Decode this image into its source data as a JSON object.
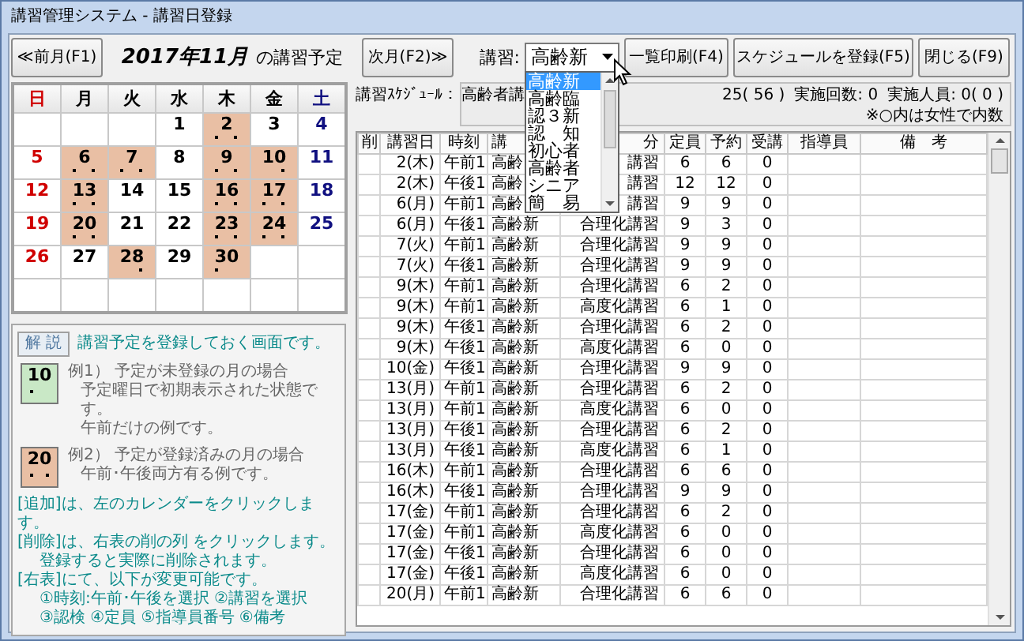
{
  "window": {
    "title": "講習管理システム - 講習日登録"
  },
  "toolbar": {
    "prev_button": "≪前月(F1)",
    "month": "2017年11月",
    "month_caption": "の講習予定",
    "next_button": "次月(F2)≫",
    "course_label": "講習:",
    "course_combo": {
      "value": "高齢新",
      "expanded": true,
      "options": [
        {
          "label": "高齢新",
          "selected": true
        },
        {
          "label": "高齢臨",
          "selected": false
        },
        {
          "label": "認３新",
          "selected": false
        },
        {
          "label": "認　知",
          "selected": false
        },
        {
          "label": "初心者",
          "selected": false
        },
        {
          "label": "高齢者",
          "selected": false
        },
        {
          "label": "シニア",
          "selected": false
        },
        {
          "label": "簡　易",
          "selected": false
        }
      ]
    },
    "buttons": [
      "一覧印刷(F4)",
      "スケジュールを登録(F5)",
      "閉じる(F9)"
    ]
  },
  "calendar": {
    "weekdays": [
      "日",
      "月",
      "火",
      "水",
      "木",
      "金",
      "土"
    ],
    "weeks": [
      [
        {
          "kind": "blank"
        },
        {
          "kind": "blank"
        },
        {
          "kind": "blank"
        },
        {
          "day": "1",
          "scheduled": false,
          "am": false,
          "pm": false
        },
        {
          "day": "2",
          "scheduled": true,
          "am": true,
          "pm": true
        },
        {
          "day": "3",
          "scheduled": false,
          "am": false,
          "pm": false
        },
        {
          "day": "4",
          "scheduled": false,
          "am": false,
          "pm": false
        }
      ],
      [
        {
          "day": "5",
          "scheduled": false,
          "am": false,
          "pm": false
        },
        {
          "day": "6",
          "scheduled": true,
          "am": true,
          "pm": true
        },
        {
          "day": "7",
          "scheduled": true,
          "am": true,
          "pm": true
        },
        {
          "day": "8",
          "scheduled": false,
          "am": false,
          "pm": false
        },
        {
          "day": "9",
          "scheduled": true,
          "am": true,
          "pm": true
        },
        {
          "day": "10",
          "scheduled": true,
          "am": false,
          "pm": true
        },
        {
          "day": "11",
          "scheduled": false,
          "am": false,
          "pm": false
        }
      ],
      [
        {
          "day": "12",
          "scheduled": false,
          "am": false,
          "pm": false
        },
        {
          "day": "13",
          "scheduled": true,
          "am": true,
          "pm": true
        },
        {
          "day": "14",
          "scheduled": false,
          "am": false,
          "pm": false
        },
        {
          "day": "15",
          "scheduled": false,
          "am": false,
          "pm": false
        },
        {
          "day": "16",
          "scheduled": true,
          "am": true,
          "pm": true
        },
        {
          "day": "17",
          "scheduled": true,
          "am": true,
          "pm": true
        },
        {
          "day": "18",
          "scheduled": false,
          "am": false,
          "pm": false
        }
      ],
      [
        {
          "day": "19",
          "scheduled": false,
          "am": false,
          "pm": false
        },
        {
          "day": "20",
          "scheduled": true,
          "am": true,
          "pm": true
        },
        {
          "day": "21",
          "scheduled": false,
          "am": false,
          "pm": false
        },
        {
          "day": "22",
          "scheduled": false,
          "am": false,
          "pm": false
        },
        {
          "day": "23",
          "scheduled": true,
          "am": true,
          "pm": true
        },
        {
          "day": "24",
          "scheduled": true,
          "am": true,
          "pm": true
        },
        {
          "day": "25",
          "scheduled": false,
          "am": false,
          "pm": false
        }
      ],
      [
        {
          "day": "26",
          "scheduled": false,
          "am": false,
          "pm": false
        },
        {
          "day": "27",
          "scheduled": false,
          "am": false,
          "pm": false
        },
        {
          "day": "28",
          "scheduled": true,
          "am": false,
          "pm": true
        },
        {
          "day": "29",
          "scheduled": false,
          "am": false,
          "pm": false
        },
        {
          "day": "30",
          "scheduled": true,
          "am": true,
          "pm": false
        },
        {
          "kind": "blank"
        },
        {
          "kind": "blank"
        }
      ]
    ]
  },
  "legend": {
    "label": "解 説",
    "intro": "講習予定を登録しておく画面です。",
    "examples": [
      {
        "kind": "unregistered",
        "day": "10",
        "am": true,
        "pm": false,
        "lines": [
          "例1） 予定が未登録の月の場合",
          "予定曜日で初期表示された状態です。",
          "午前だけの例です。"
        ]
      },
      {
        "kind": "registered",
        "day": "20",
        "am": true,
        "pm": true,
        "lines": [
          "例2） 予定が登録済みの月の場合",
          "午前･午後両方有る例です。"
        ]
      }
    ],
    "notes": [
      {
        "text": "[追加]は、左のカレンダーをクリックします。",
        "indented": false
      },
      {
        "text": "[削除]は、右表の削の列 をクリックします。",
        "indented": false
      },
      {
        "text": "登録すると実際に削除されます。",
        "indented": true
      },
      {
        "text": "[右表]にて、以下が変更可能です。",
        "indented": false
      },
      {
        "text": "①時刻:午前･午後を選択 ②講習を選択",
        "indented": true
      },
      {
        "text": "③認検 ④定員 ⑤指導員番号 ⑥備考",
        "indented": true
      }
    ]
  },
  "schedule": {
    "label": "講習ｽｹｼﾞｭｰﾙ：",
    "course": "高齢者講",
    "stats": [
      "25( 56 )",
      "実施回数: 0",
      "実施人員: 0( 0 )",
      "※○内は女性で内数"
    ]
  },
  "table": {
    "columns": [
      "削",
      "講習日",
      "時刻",
      "講",
      "分",
      "定員",
      "予約",
      "受講",
      "指導員",
      "備　考"
    ],
    "rows": [
      {
        "date": "2(木)",
        "time": "午前1",
        "course": "高齢",
        "division": "講習",
        "capacity": "6",
        "reserved": "6",
        "attended": "0"
      },
      {
        "date": "2(木)",
        "time": "午後1",
        "course": "高齢",
        "division": "講習",
        "capacity": "12",
        "reserved": "12",
        "attended": "0"
      },
      {
        "date": "6(月)",
        "time": "午前1",
        "course": "高齢",
        "division": "講習",
        "capacity": "9",
        "reserved": "9",
        "attended": "0"
      },
      {
        "date": "6(月)",
        "time": "午後1",
        "course": "高齢新",
        "division": "合理化講習",
        "capacity": "9",
        "reserved": "3",
        "attended": "0"
      },
      {
        "date": "7(火)",
        "time": "午前1",
        "course": "高齢新",
        "division": "合理化講習",
        "capacity": "9",
        "reserved": "9",
        "attended": "0"
      },
      {
        "date": "7(火)",
        "time": "午後1",
        "course": "高齢新",
        "division": "合理化講習",
        "capacity": "9",
        "reserved": "9",
        "attended": "0"
      },
      {
        "date": "9(木)",
        "time": "午前1",
        "course": "高齢新",
        "division": "合理化講習",
        "capacity": "6",
        "reserved": "2",
        "attended": "0"
      },
      {
        "date": "9(木)",
        "time": "午前1",
        "course": "高齢新",
        "division": "高度化講習",
        "capacity": "6",
        "reserved": "1",
        "attended": "0"
      },
      {
        "date": "9(木)",
        "time": "午後1",
        "course": "高齢新",
        "division": "合理化講習",
        "capacity": "6",
        "reserved": "2",
        "attended": "0"
      },
      {
        "date": "9(木)",
        "time": "午後1",
        "course": "高齢新",
        "division": "高度化講習",
        "capacity": "6",
        "reserved": "0",
        "attended": "0"
      },
      {
        "date": "10(金)",
        "time": "午後1",
        "course": "高齢新",
        "division": "合理化講習",
        "capacity": "9",
        "reserved": "9",
        "attended": "0"
      },
      {
        "date": "13(月)",
        "time": "午前1",
        "course": "高齢新",
        "division": "合理化講習",
        "capacity": "6",
        "reserved": "2",
        "attended": "0"
      },
      {
        "date": "13(月)",
        "time": "午前1",
        "course": "高齢新",
        "division": "高度化講習",
        "capacity": "6",
        "reserved": "0",
        "attended": "0"
      },
      {
        "date": "13(月)",
        "time": "午後1",
        "course": "高齢新",
        "division": "合理化講習",
        "capacity": "6",
        "reserved": "2",
        "attended": "0"
      },
      {
        "date": "13(月)",
        "time": "午後1",
        "course": "高齢新",
        "division": "高度化講習",
        "capacity": "6",
        "reserved": "1",
        "attended": "0"
      },
      {
        "date": "16(木)",
        "time": "午前1",
        "course": "高齢新",
        "division": "合理化講習",
        "capacity": "6",
        "reserved": "6",
        "attended": "0"
      },
      {
        "date": "16(木)",
        "time": "午後1",
        "course": "高齢新",
        "division": "合理化講習",
        "capacity": "9",
        "reserved": "9",
        "attended": "0"
      },
      {
        "date": "17(金)",
        "time": "午前1",
        "course": "高齢新",
        "division": "合理化講習",
        "capacity": "6",
        "reserved": "2",
        "attended": "0"
      },
      {
        "date": "17(金)",
        "time": "午前1",
        "course": "高齢新",
        "division": "高度化講習",
        "capacity": "6",
        "reserved": "0",
        "attended": "0"
      },
      {
        "date": "17(金)",
        "time": "午後1",
        "course": "高齢新",
        "division": "合理化講習",
        "capacity": "6",
        "reserved": "0",
        "attended": "0"
      },
      {
        "date": "17(金)",
        "time": "午後1",
        "course": "高齢新",
        "division": "高度化講習",
        "capacity": "6",
        "reserved": "0",
        "attended": "0"
      },
      {
        "date": "20(月)",
        "time": "午前1",
        "course": "高齢新",
        "division": "合理化講習",
        "capacity": "6",
        "reserved": "6",
        "attended": "0"
      }
    ]
  }
}
